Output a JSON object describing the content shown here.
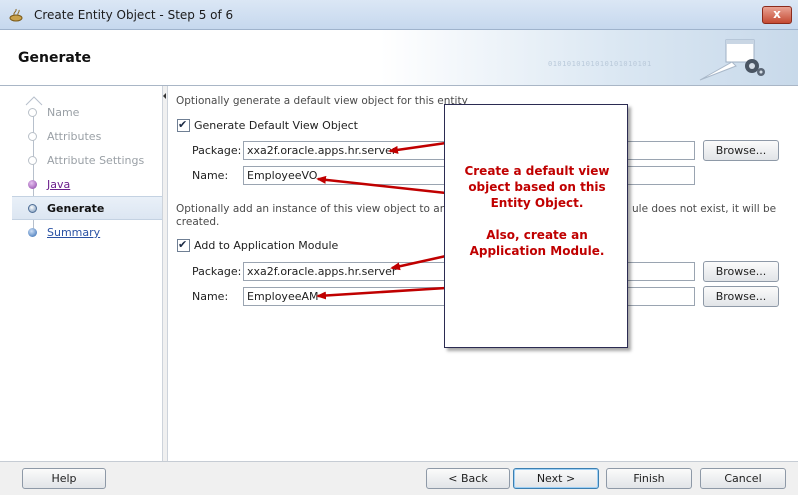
{
  "window": {
    "title": "Create Entity Object - Step 5 of 6",
    "close_label": "x"
  },
  "header": {
    "title": "Generate",
    "binary_decoration": "0101010101010101010101"
  },
  "nav": {
    "items": [
      {
        "label": "Name"
      },
      {
        "label": "Attributes"
      },
      {
        "label": "Attribute Settings"
      },
      {
        "label": "Java"
      },
      {
        "label": "Generate"
      },
      {
        "label": "Summary"
      }
    ]
  },
  "main": {
    "intro_vo": "Optionally generate a default view object for this entity",
    "generate_vo_label": "Generate Default View Object",
    "vo_package_label": "Package:",
    "vo_package_value": "xxa2f.oracle.apps.hr.server",
    "vo_name_label": "Name:",
    "vo_name_value": "EmployeeVO",
    "intro_am_start": "Optionally add an instance of this view object to an appli",
    "intro_am_end": "ule does not exist, it will be",
    "intro_am_line2": "created.",
    "add_am_label": "Add to Application Module",
    "am_package_label": "Package:",
    "am_package_value": "xxa2f.oracle.apps.hr.server",
    "am_name_label": "Name:",
    "am_name_value": "EmployeeAM",
    "browse_label": "Browse..."
  },
  "callout": {
    "line1": "Create a default view object based on this Entity Object.",
    "line2": "Also, create an Application Module."
  },
  "footer": {
    "help": "Help",
    "back": "< Back",
    "next": "Next >",
    "finish": "Finish",
    "cancel": "Cancel"
  },
  "colors": {
    "accent_red": "#c00000",
    "callout_border": "#2b2b52",
    "link_blue": "#2a52a4",
    "visited_purple": "#6b1f8c"
  }
}
